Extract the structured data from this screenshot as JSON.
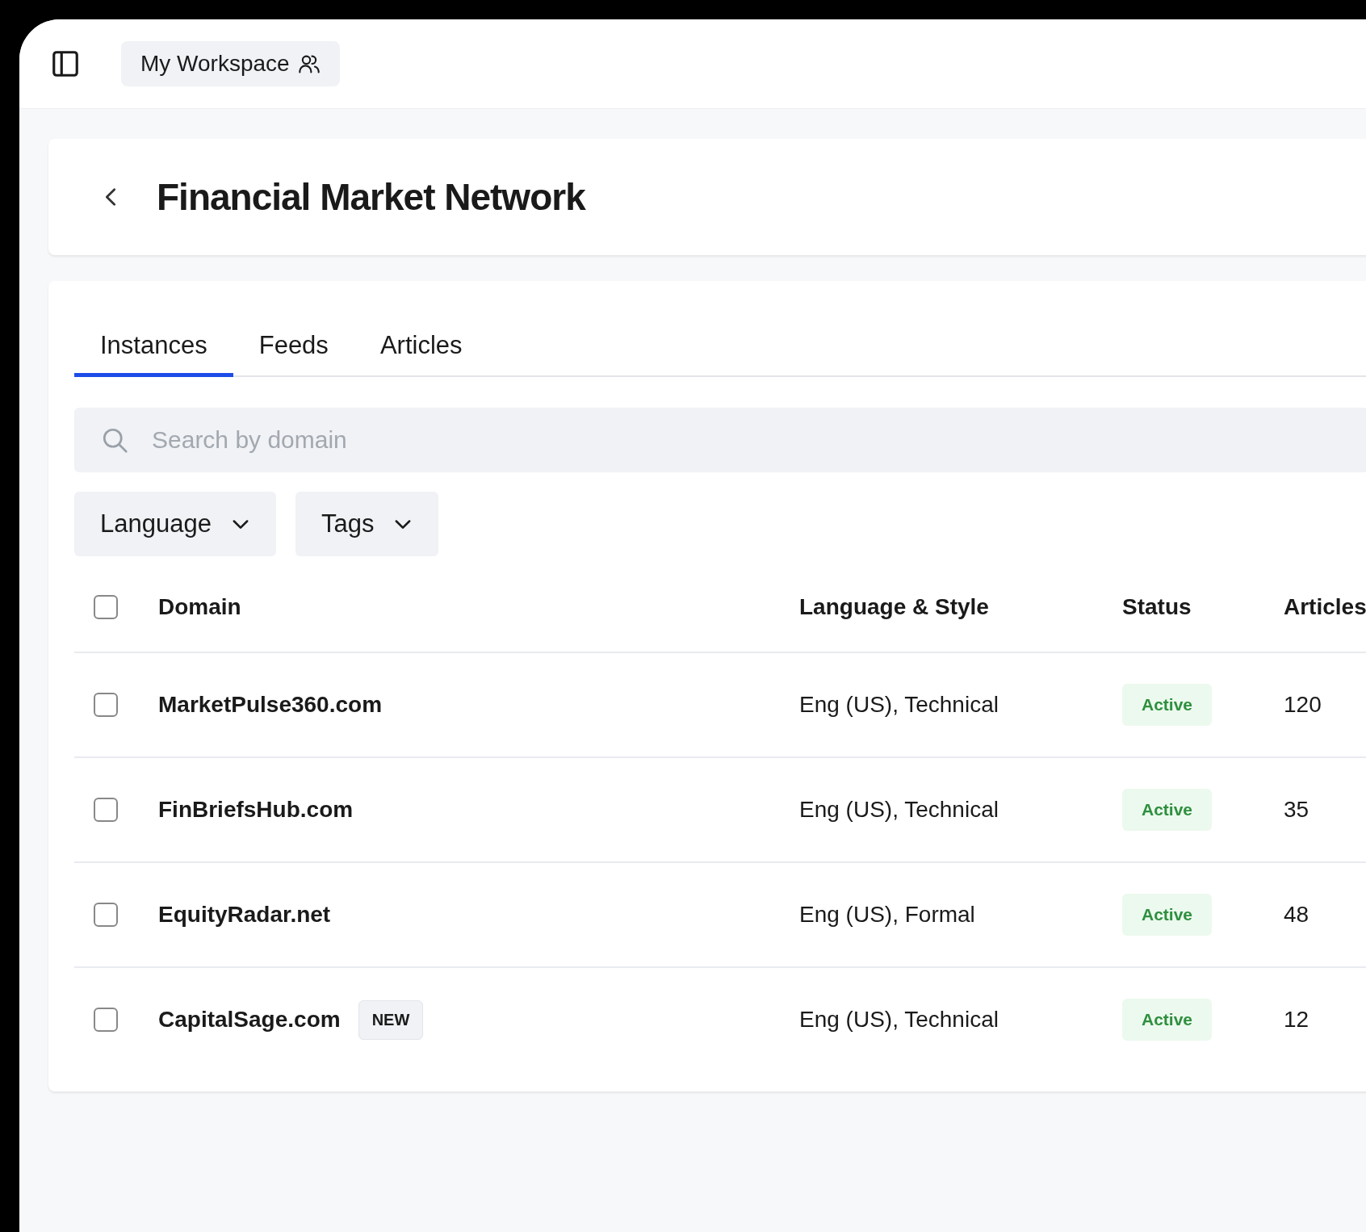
{
  "topbar": {
    "workspace": "My Workspace"
  },
  "header": {
    "title": "Financial Market Network"
  },
  "tabs": [
    {
      "label": "Instances",
      "selected": true
    },
    {
      "label": "Feeds",
      "selected": false
    },
    {
      "label": "Articles",
      "selected": false
    }
  ],
  "search": {
    "placeholder": "Search by domain"
  },
  "filters": [
    {
      "label": "Language"
    },
    {
      "label": "Tags"
    }
  ],
  "table": {
    "select_all": {
      "checked": false
    },
    "columns": [
      "Domain",
      "Language & Style",
      "Status",
      "Articles"
    ],
    "rows": [
      {
        "checked": false,
        "domain": "MarketPulse360.com",
        "language_style": "Eng (US), Technical",
        "status": "Active",
        "articles": "120"
      },
      {
        "checked": false,
        "domain": "FinBriefsHub.com",
        "language_style": "Eng (US), Technical",
        "status": "Active",
        "articles": "35"
      },
      {
        "checked": false,
        "domain": "EquityRadar.net",
        "language_style": "Eng (US), Formal",
        "status": "Active",
        "articles": "48"
      },
      {
        "checked": false,
        "domain": "CapitalSage.com",
        "badge": "NEW",
        "language_style": "Eng (US), Technical",
        "status": "Active",
        "articles": "12"
      }
    ]
  }
}
